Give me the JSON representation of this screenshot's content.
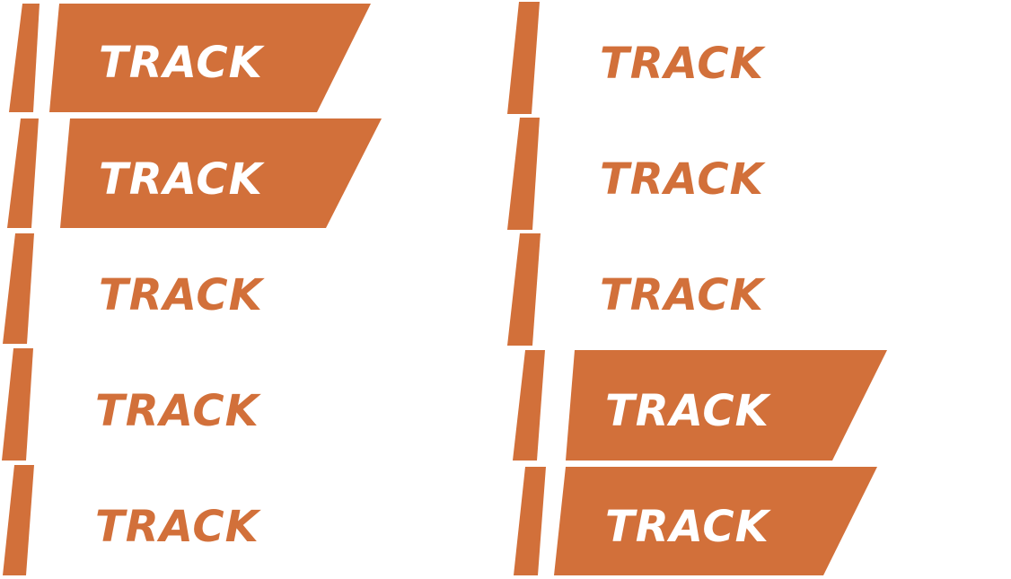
{
  "accent_color": "#D2703A",
  "background_color": "#FFFFFF",
  "label_text": "TRACK",
  "buttons": [
    {
      "column": "left",
      "row": 1,
      "state": "filled",
      "label": "TRACK"
    },
    {
      "column": "left",
      "row": 2,
      "state": "filled",
      "label": "TRACK"
    },
    {
      "column": "left",
      "row": 3,
      "state": "outline",
      "label": "TRACK"
    },
    {
      "column": "left",
      "row": 4,
      "state": "outline",
      "label": "TRACK"
    },
    {
      "column": "left",
      "row": 5,
      "state": "outline",
      "label": "TRACK"
    },
    {
      "column": "right",
      "row": 1,
      "state": "outline",
      "label": "TRACK"
    },
    {
      "column": "right",
      "row": 2,
      "state": "outline",
      "label": "TRACK"
    },
    {
      "column": "right",
      "row": 3,
      "state": "outline",
      "label": "TRACK"
    },
    {
      "column": "right",
      "row": 4,
      "state": "filled",
      "label": "TRACK"
    },
    {
      "column": "right",
      "row": 5,
      "state": "filled",
      "label": "TRACK"
    }
  ]
}
